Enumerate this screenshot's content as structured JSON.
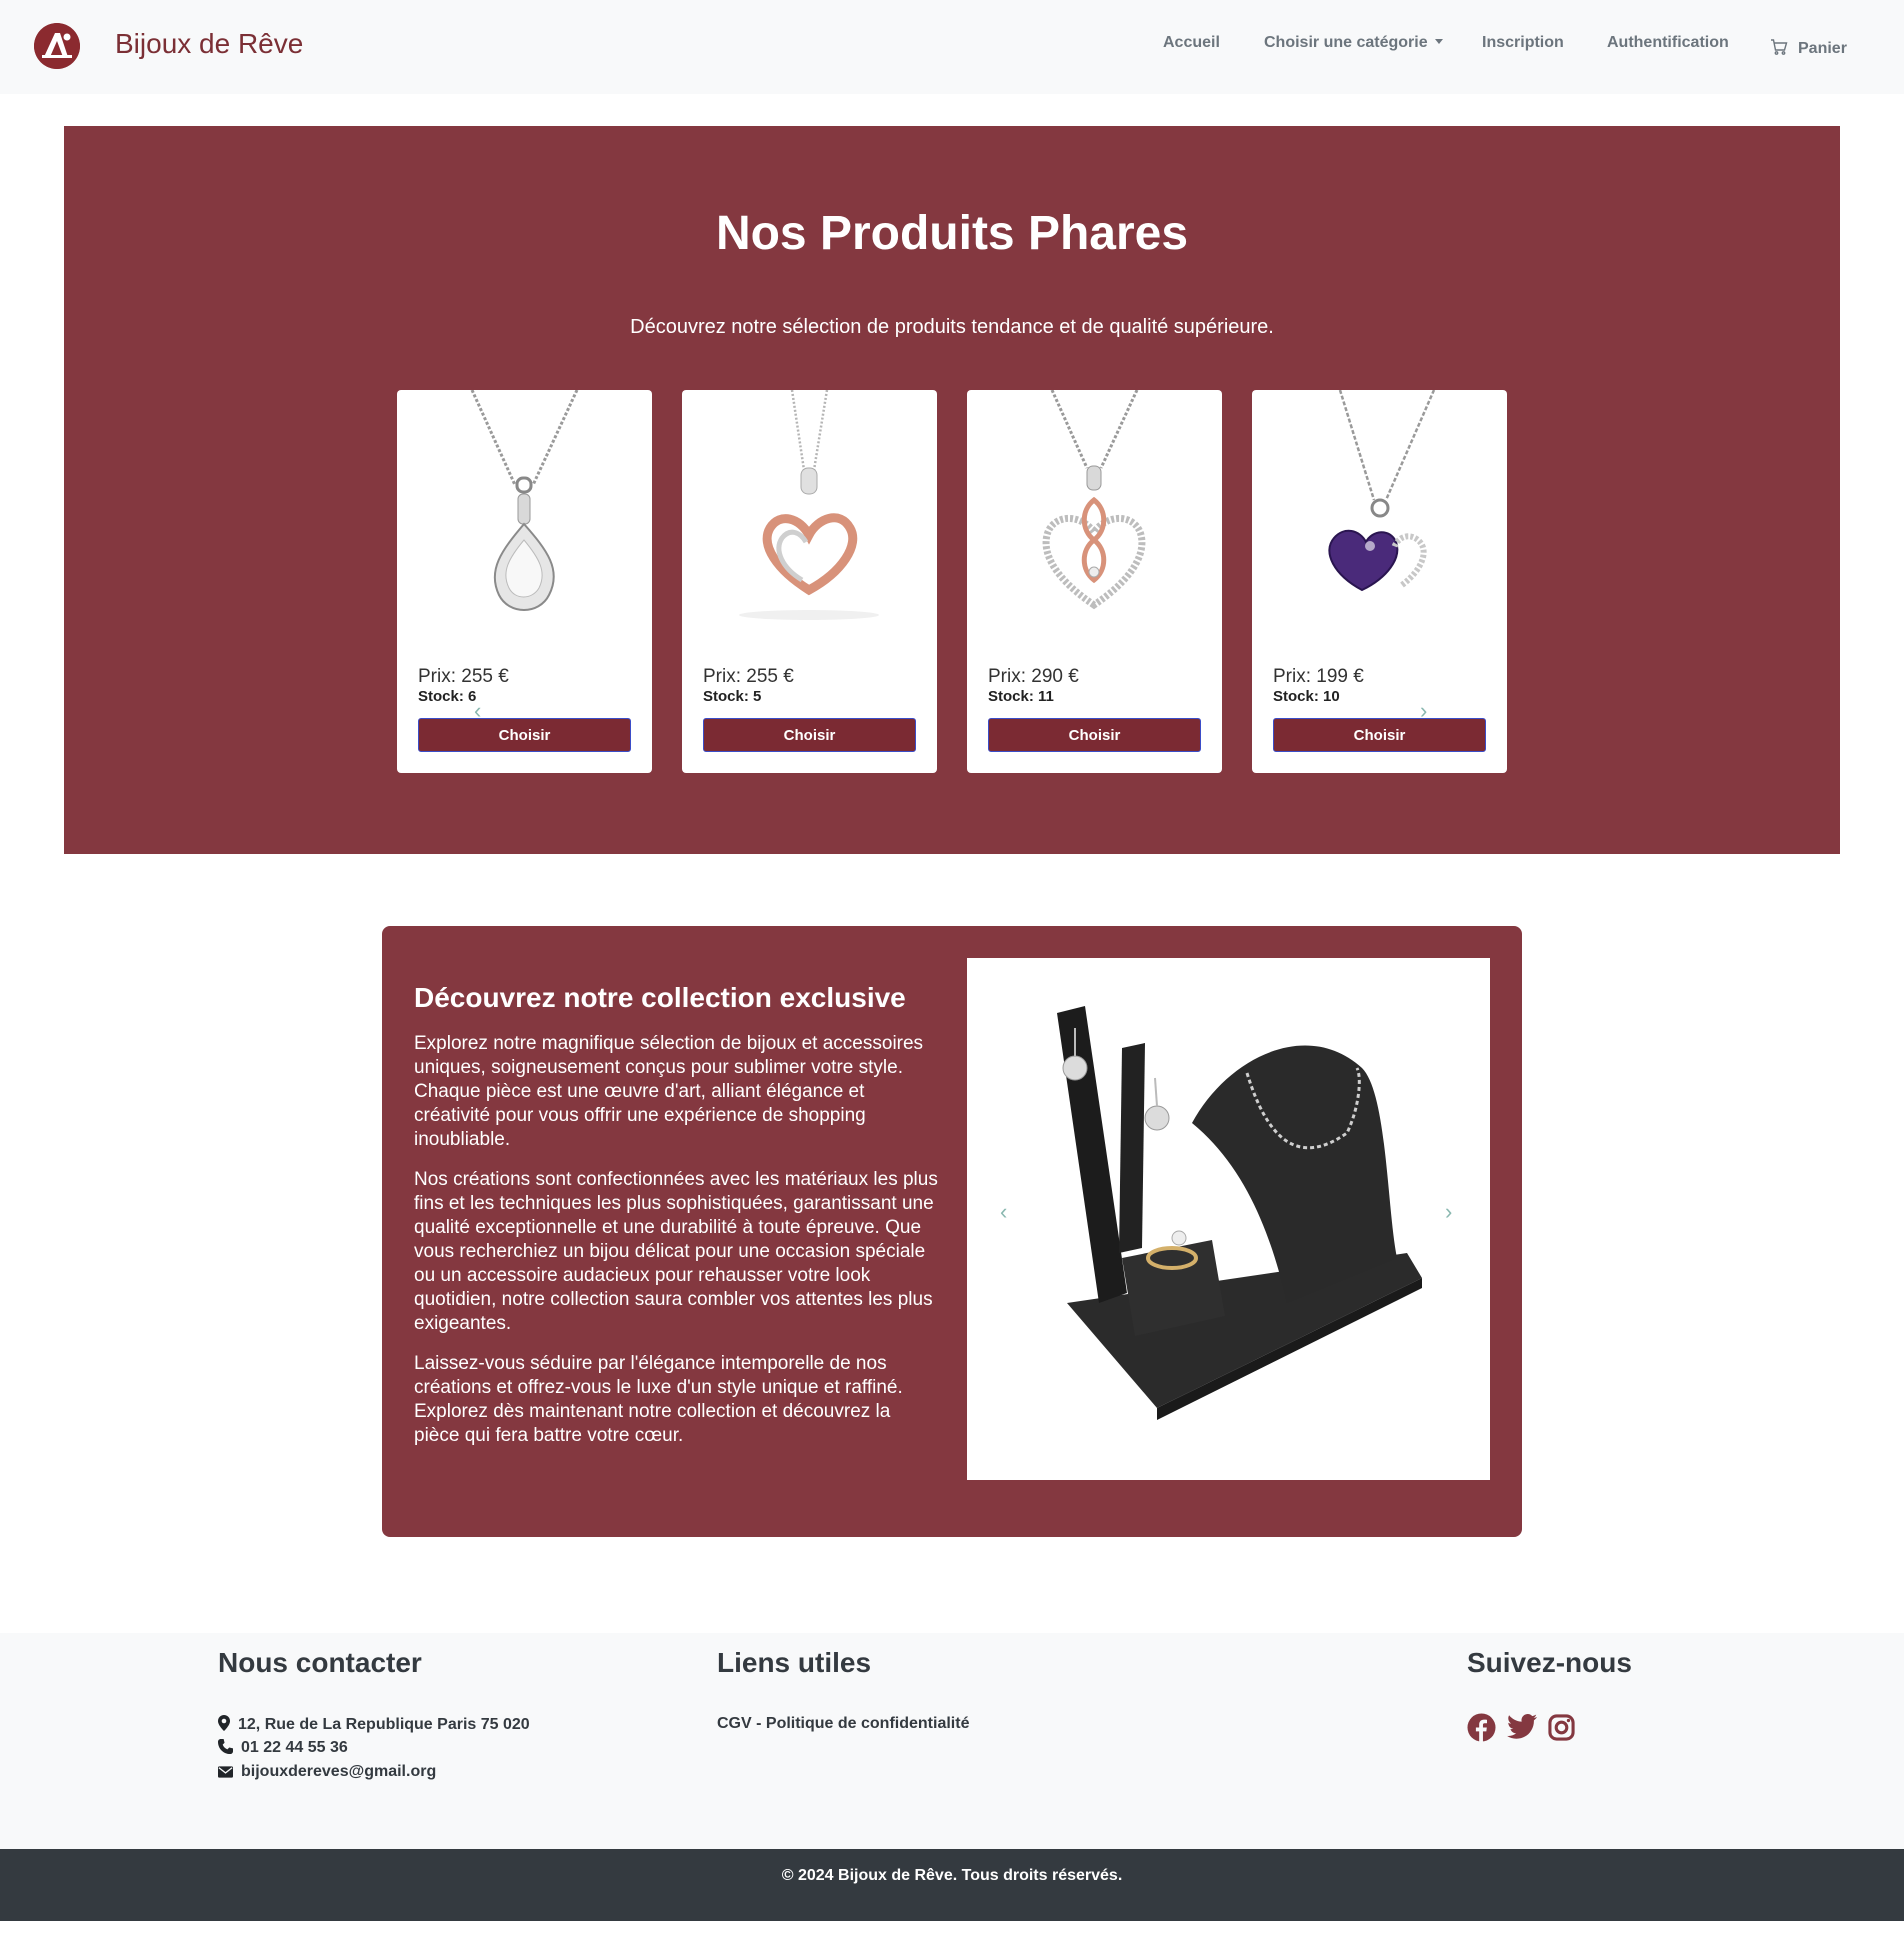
{
  "navbar": {
    "brand": "Bijoux de Rêve",
    "accueil": "Accueil",
    "category": "Choisir une catégorie",
    "inscription": "Inscription",
    "auth": "Authentification",
    "cart": "Panier"
  },
  "hero": {
    "title": "Nos Produits Phares",
    "subtitle": "Découvrez notre sélection de produits tendance et de qualité supérieure.",
    "products": [
      {
        "price": "Prix: 255 €",
        "stock": "Stock: 6",
        "button": "Choisir"
      },
      {
        "price": "Prix: 255 €",
        "stock": "Stock: 5",
        "button": "Choisir"
      },
      {
        "price": "Prix: 290 €",
        "stock": "Stock: 11",
        "button": "Choisir"
      },
      {
        "price": "Prix: 199 €",
        "stock": "Stock: 10",
        "button": "Choisir"
      }
    ]
  },
  "collection": {
    "title": "Découvrez notre collection exclusive",
    "paragraphs": [
      "Explorez notre magnifique sélection de bijoux et accessoires uniques, soigneusement conçus pour sublimer votre style. Chaque pièce est une œuvre d'art, alliant élégance et créativité pour vous offrir une expérience de shopping inoubliable.",
      "Nos créations sont confectionnées avec les matériaux les plus fins et les techniques les plus sophistiquées, garantissant une qualité exceptionnelle et une durabilité à toute épreuve. Que vous recherchiez un bijou délicat pour une occasion spéciale ou un accessoire audacieux pour rehausser votre look quotidien, notre collection saura combler vos attentes les plus exigeantes.",
      "Laissez-vous séduire par l'élégance intemporelle de nos créations et offrez-vous le luxe d'un style unique et raffiné. Explorez dès maintenant notre collection et découvrez la pièce qui fera battre votre cœur."
    ]
  },
  "footer": {
    "contact_title": "Nous contacter",
    "address": "12, Rue de La Republique Paris 75 020",
    "phone": "01 22 44 55 36",
    "email": "bijouxdereves@gmail.org",
    "links_title": "Liens utiles",
    "link_cgv": "CGV - Politique de confidentialité",
    "follow_title": "Suivez-nous",
    "social_icons": [
      "facebook-icon",
      "twitter-icon",
      "instagram-icon"
    ]
  },
  "copyright": "© 2024 Bijoux de Rêve. Tous droits réservés.",
  "colors": {
    "brand": "#843840",
    "button": "#7b2a33",
    "footer_dark": "#343a40",
    "footer_light": "#f8f9fa"
  }
}
